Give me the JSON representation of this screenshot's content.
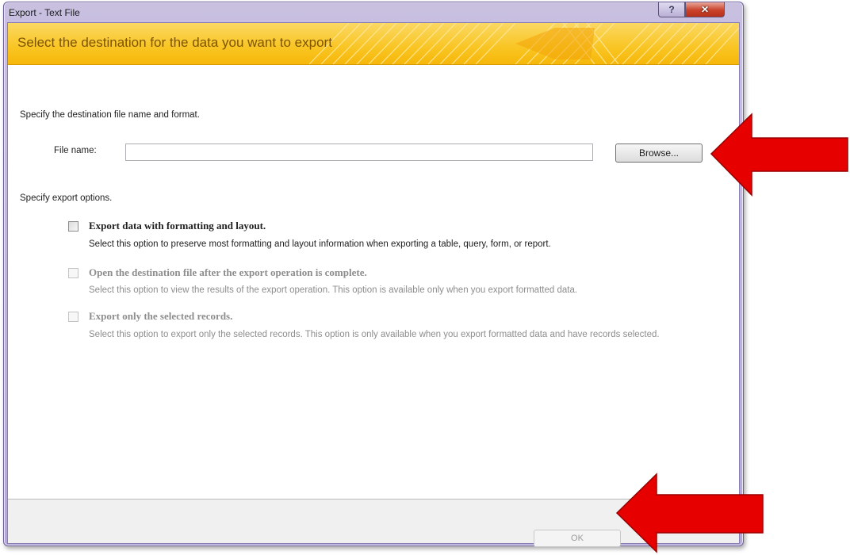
{
  "window": {
    "title": "Export - Text File",
    "help_label": "?",
    "close_label": "✕"
  },
  "banner": {
    "title": "Select the destination for the data you want to export"
  },
  "destination": {
    "heading": "Specify the destination file name and format.",
    "file_name_label": "File name:",
    "file_name_value": "",
    "browse_label": "Browse..."
  },
  "options": {
    "heading": "Specify export options.",
    "items": [
      {
        "title": "Export data with formatting and layout.",
        "description": "Select this option to preserve most formatting and layout information when exporting a table, query, form, or report.",
        "enabled": true
      },
      {
        "title": "Open the destination file after the export operation is complete.",
        "description": "Select this option to view the results of the export operation. This option is available only when you export formatted data.",
        "enabled": false
      },
      {
        "title": "Export only the selected records.",
        "description": "Select this option to export only the selected records. This option is only available when you export formatted data and have records selected.",
        "enabled": false
      }
    ]
  },
  "footer": {
    "ok_label": "OK"
  },
  "annotations": {
    "arrow_color": "#e60000"
  }
}
